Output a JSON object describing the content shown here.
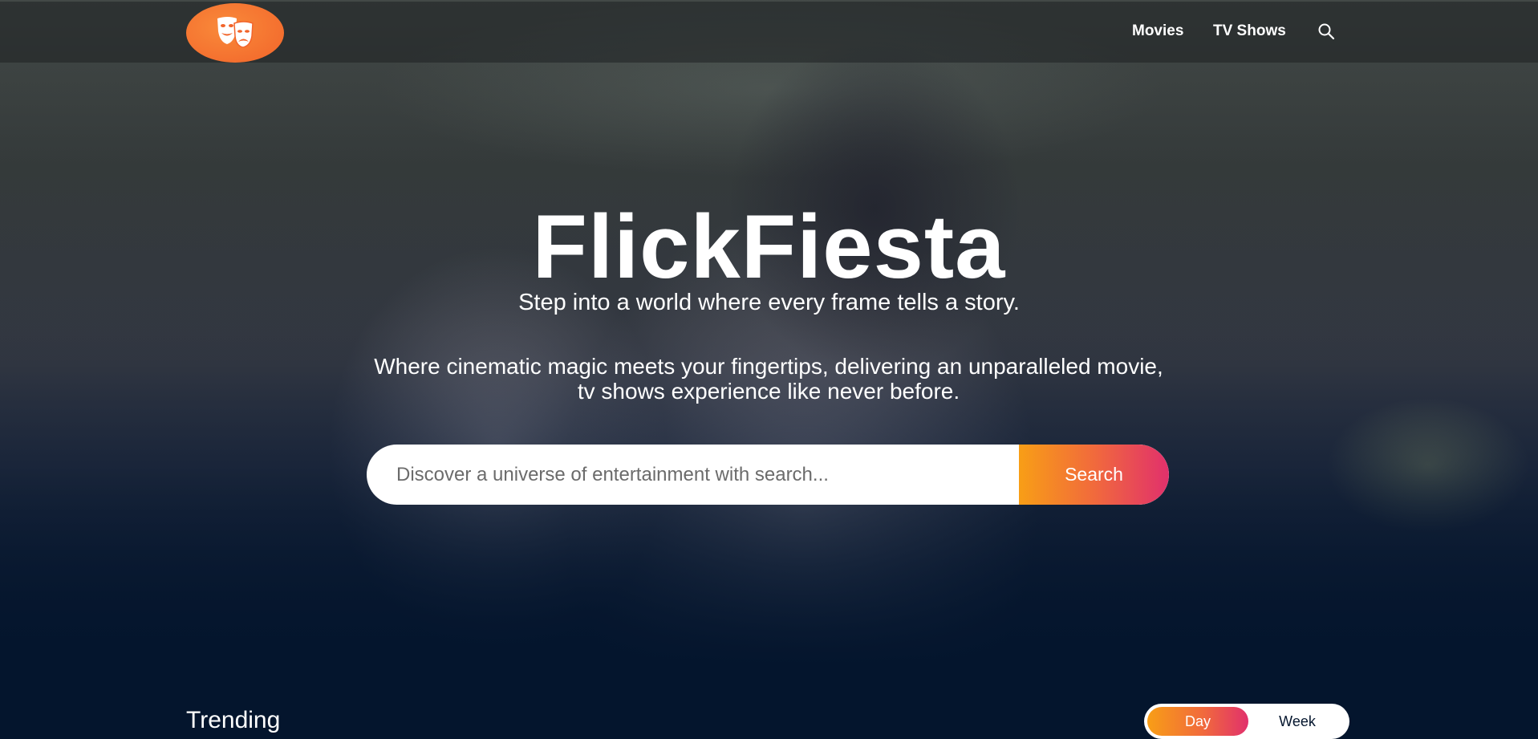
{
  "header": {
    "logo_icon": "theater-masks-icon",
    "nav": {
      "movies_label": "Movies",
      "tvshows_label": "TV Shows",
      "search_icon": "search-icon"
    }
  },
  "hero": {
    "title": "FlickFiesta",
    "subtitle": "Step into a world where every frame tells a story.",
    "description": "Where cinematic magic meets your fingertips, delivering an unparalleled movie, tv shows experience like never before.",
    "search": {
      "placeholder": "Discover a universe of entertainment with search...",
      "value": "",
      "button_label": "Search"
    }
  },
  "trending": {
    "title": "Trending",
    "tabs": [
      {
        "label": "Day",
        "active": true
      },
      {
        "label": "Week",
        "active": false
      }
    ]
  },
  "colors": {
    "background": "#04152d",
    "accent_orange": "#f89e16",
    "accent_pink": "#e1306c",
    "logo": "#f2642a"
  }
}
